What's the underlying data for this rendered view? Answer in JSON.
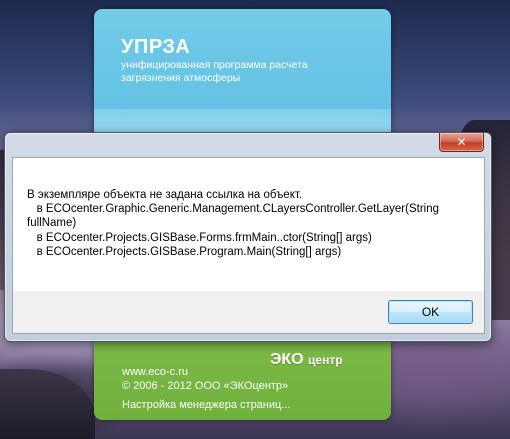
{
  "splash": {
    "title": "УПРЗА",
    "subtitle": "унифицированная программа расчета загрязнения атмосферы",
    "brand": "ЭКО",
    "brand_suffix": "центр",
    "url": "www.eco-c.ru",
    "copyright": "© 2006 - 2012 ООО «ЭКОцентр»",
    "status": "Настройка менеджера страниц..."
  },
  "dialog": {
    "close_glyph": "✕",
    "message_lines": [
      "В экземпляре объекта не задана ссылка на объект.",
      "   в ECOcenter.Graphic.Generic.Management.CLayersController.GetLayer(String",
      "fullName)",
      "   в ECOcenter.Projects.GISBase.Forms.frmMain..ctor(String[] args)",
      "   в ECOcenter.Projects.GISBase.Program.Main(String[] args)"
    ],
    "ok_label": "OK"
  },
  "colors": {
    "splash_blue": "#64c2e4",
    "splash_green": "#8cc553",
    "close_red": "#c43a22",
    "ok_border": "#3c7fb1"
  },
  "icons": {
    "close": "close-icon"
  }
}
